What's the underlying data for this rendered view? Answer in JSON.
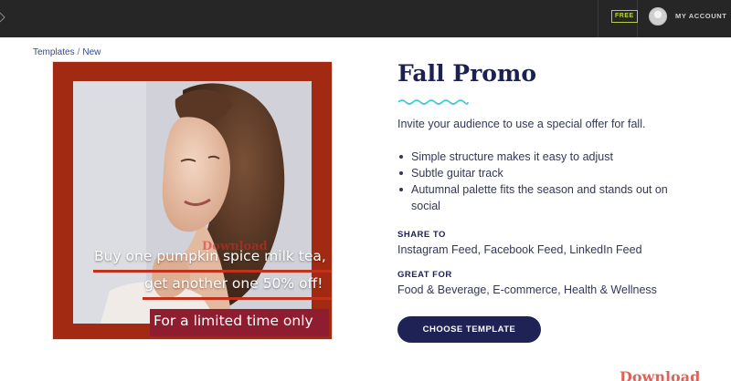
{
  "topbar": {
    "free_badge": "FREE",
    "account_label": "MY ACCOUNT"
  },
  "breadcrumb": {
    "root": "Templates",
    "separator": "/",
    "current": "New"
  },
  "preview": {
    "promo_line_1": "Buy one pumpkin spice milk tea,",
    "promo_line_2": "get another one 50% off!",
    "limited_time": "For a limited time only",
    "watermark": "Download"
  },
  "template": {
    "title": "Fall Promo",
    "description": "Invite your audience to use a special offer for fall.",
    "features": [
      "Simple structure makes it easy to adjust",
      "Subtle guitar track",
      "Autumnal palette fits the season and stands out on social"
    ],
    "share_to_label": "SHARE TO",
    "share_to_value": "Instagram Feed, Facebook Feed, LinkedIn Feed",
    "great_for_label": "GREAT FOR",
    "great_for_value": "Food & Beverage, E-commerce, Health & Wellness",
    "choose_button": "CHOOSE TEMPLATE"
  },
  "corner_watermark": "Download",
  "colors": {
    "topbar_bg": "#262626",
    "free_badge": "#b7d13a",
    "accent_wave": "#3fc6d0",
    "primary_button": "#1e2255",
    "preview_frame": "#a32a12",
    "limited_banner": "#8d1d2f"
  },
  "icons": {
    "profile": "avatar-icon",
    "decor": "wavy-line-icon"
  }
}
